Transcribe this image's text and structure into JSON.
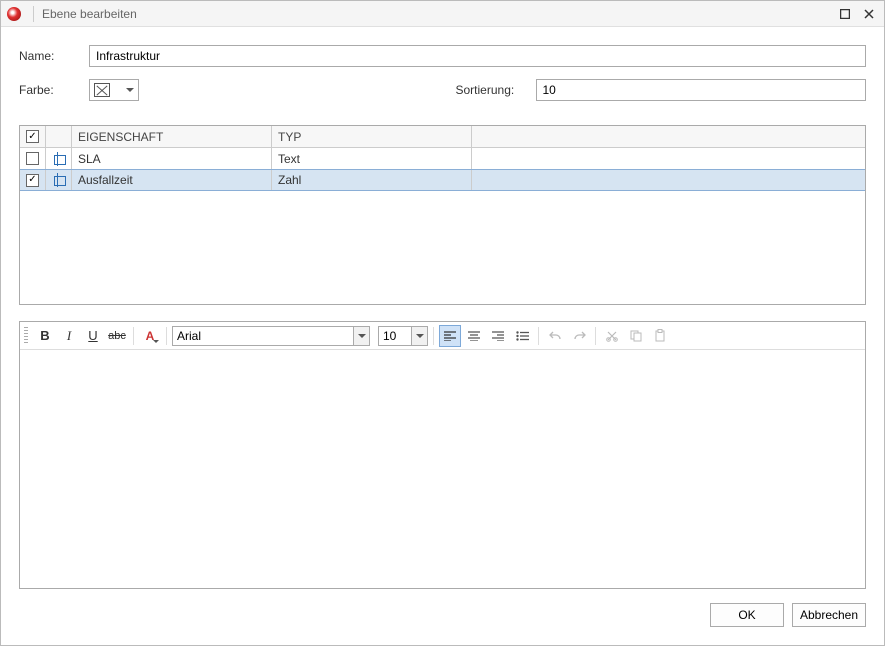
{
  "window": {
    "title": "Ebene bearbeiten"
  },
  "form": {
    "name_label": "Name:",
    "name_value": "Infrastruktur",
    "color_label": "Farbe:",
    "color_value": "none",
    "sort_label": "Sortierung:",
    "sort_value": "10"
  },
  "grid": {
    "headers": {
      "property": "EIGENSCHAFT",
      "type": "TYP"
    },
    "rows": [
      {
        "checked": false,
        "property": "SLA",
        "type": "Text",
        "selected": false
      },
      {
        "checked": true,
        "property": "Ausfallzeit",
        "type": "Zahl",
        "selected": true
      }
    ]
  },
  "editor": {
    "font": "Arial",
    "font_size": "10",
    "content": ""
  },
  "buttons": {
    "ok": "OK",
    "cancel": "Abbrechen"
  }
}
